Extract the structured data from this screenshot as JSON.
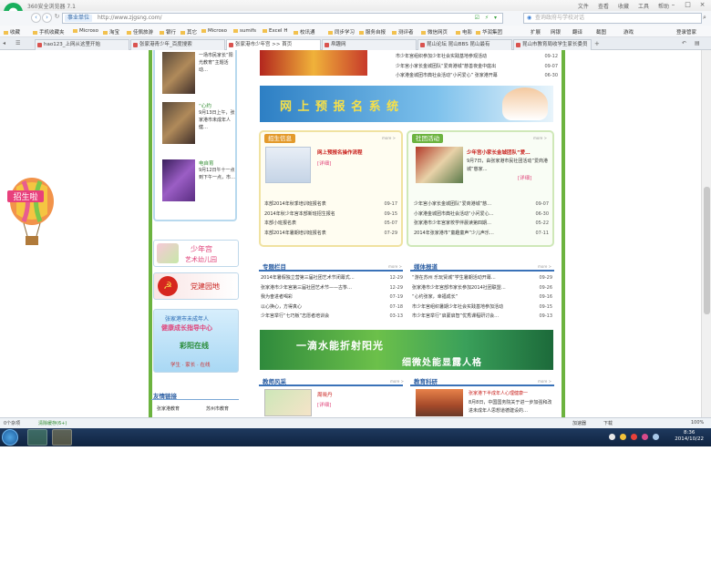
{
  "browser": {
    "title": "360安全浏览器 7.1",
    "menus": [
      "文件",
      "查看",
      "收藏",
      "工具",
      "帮助"
    ],
    "address_badge": "事业单位",
    "url": "http://www.zjgsng.com/",
    "search_placeholder": "查询政府与学校对话"
  },
  "bookmarks": [
    "收藏",
    "手机收藏夹",
    "Microso",
    "淘宝",
    "佳佩旅游",
    "银行",
    "其它",
    "Microso",
    "sumifs",
    "Excel H",
    "校讯通",
    "同步学习",
    "服务自报",
    "测评者",
    "微信网页",
    "电影",
    "华润集团"
  ],
  "toolbar_right": [
    "扩展",
    "网银",
    "翻译",
    "截图",
    "游戏",
    "登录管家"
  ],
  "tabs": [
    "hao123_上网从这里开始",
    "张家港青少年_百度搜索",
    "张家港市少年宫 >> 首页",
    "帛趣网",
    "昆山论坛 昆山BBS 昆山最有",
    "昆山市教育局收学生家长委员"
  ],
  "site": {
    "left_news": [
      {
        "title": "",
        "text": "一场市民家长”阳光教育”主题活动…"
      },
      {
        "title": "“心约",
        "text": "9月13日上午，张家港市未成年人健…"
      },
      {
        "title": "电自育",
        "text": "9月12日午十一点到下午一点，市…"
      }
    ],
    "kindergarten": {
      "line1": "少年宫",
      "line2": "艺术幼儿园"
    },
    "party": "党建园地",
    "guide": {
      "line1": "张家港市未成年人",
      "line2": "健康成长指导中心",
      "line3": "彩阳在线",
      "line4": "学生 · 家长 · 在线"
    },
    "friend_links": {
      "title": "友情链接",
      "links": [
        "张家港教育",
        "苏州市教育"
      ]
    },
    "top_list": [
      {
        "t": "市少年宫组织参加少年社会实践基地参观活动",
        "d": "09-12"
      },
      {
        "t": "少年宫小家长金城团队“爱商港城”慈善夜金中庭出",
        "d": "09-07"
      },
      {
        "t": "小家港金城团市典社会活动“小问爱心” 张家港开幕",
        "d": "06-30"
      }
    ],
    "signup_banner": "网 上 预 报 名 系 统",
    "recruit": {
      "title": "招生信息",
      "more": "more >",
      "feature_title": "网上预报名操作流程",
      "feature_link": "[详细]",
      "items": [
        {
          "t": "本部2014年秋季培训班报名表",
          "d": "09-17"
        },
        {
          "t": "2014年秋少年宫本部新班招生报名",
          "d": "09-15"
        },
        {
          "t": "本部小班报名表",
          "d": "05-07"
        },
        {
          "t": "本部2014年暑期培训班报名表",
          "d": "07-29"
        }
      ]
    },
    "clubs": {
      "title": "社团活动",
      "more": "more >",
      "feature_title": "少年宫小家长金城团队”爱…",
      "feature_text": "9月7日，由张家港市民社团活动”爱商港城”慈家…",
      "feature_link": "[详细]",
      "items": [
        {
          "t": "少年宫小家长金城团队“爱商港城”慈…",
          "d": "09-07"
        },
        {
          "t": "小家港金城团市典社会活动“小问爱心…",
          "d": "06-30"
        },
        {
          "t": "张家港市少年宫家校学伴晨读第四期…",
          "d": "05-22"
        },
        {
          "t": "2014年张家港市“童趣童声”少儿声乐…",
          "d": "07-11"
        }
      ]
    },
    "special": {
      "title": "专题栏目",
      "more": "more >",
      "items": [
        {
          "t": "2014年暑假独立营第三届社团艺术节闭幕式…",
          "d": "12-29"
        },
        {
          "t": "张家港市少年宫第三届社团艺术节——古筝…",
          "d": "12-29"
        },
        {
          "t": "我为奋进者喝彩",
          "d": "07-19"
        },
        {
          "t": "以心换心，方得真心",
          "d": "07-18"
        },
        {
          "t": "少年宫举行“七巧板”志愿者培训会",
          "d": "03-13"
        }
      ]
    },
    "media": {
      "title": "媒体报道",
      "more": "more >",
      "items": [
        {
          "t": "“游在苏州 乐玩贤城”学生暑期活动开幕…",
          "d": "09-29"
        },
        {
          "t": "张家港市少年宫部市家长参加2014社团联盟…",
          "d": "09-26"
        },
        {
          "t": "“心约张家，幸福成长”",
          "d": "09-16"
        },
        {
          "t": "市少年宫组织暑期少年社会实践基地参加活动",
          "d": "09-15"
        },
        {
          "t": "市少年宫举行“启蒙启智”优秀课程研讨会…",
          "d": "09-13"
        }
      ]
    },
    "water_banner": {
      "line1": "一滴水能折射阳光",
      "line2": "细微处能显露人格"
    },
    "teachers": {
      "title": "教师风采",
      "more": "more >",
      "name": "周晓丹",
      "link": "[详细]"
    },
    "research": {
      "title": "教育科研",
      "more": "more >",
      "headline": "张家港下半成年人心理健康一",
      "text": "8月8日，中国国务院关于进一步加强和改进未成年人思想道德建设的…"
    }
  },
  "statusbar": {
    "left1": "0个杂项",
    "left2": "清除缓存(6+)",
    "right": [
      "加速器",
      "下载",
      "100%"
    ]
  },
  "taskbar": {
    "time": "8:36",
    "date": "2014/10/22"
  }
}
